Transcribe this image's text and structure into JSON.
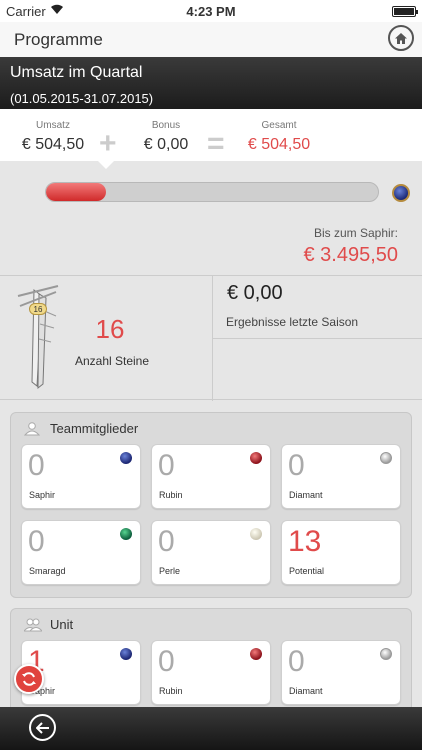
{
  "statusbar": {
    "carrier": "Carrier",
    "time": "4:23 PM"
  },
  "navbar": {
    "title": "Programme",
    "home_icon": "home-icon"
  },
  "quarter": {
    "title": "Umsatz im Quartal",
    "period": "(01.05.2015-31.07.2015)"
  },
  "summary": {
    "umsatz_label": "Umsatz",
    "umsatz_value": "€ 504,50",
    "plus": "+",
    "bonus_label": "Bonus",
    "bonus_value": "€ 0,00",
    "equals": "=",
    "gesamt_label": "Gesamt",
    "gesamt_value": "€ 504,50"
  },
  "progress": {
    "fraction": 0.18,
    "bis_label": "Bis zum Saphir:",
    "bis_value": "€ 3.495,50"
  },
  "stones": {
    "badge": "16",
    "count": "16",
    "label": "Anzahl Steine"
  },
  "saison": {
    "value": "€ 0,00",
    "label": "Ergebnisse letzte Saison"
  },
  "team": {
    "header": "Teammitglieder",
    "cards": [
      {
        "value": "0",
        "name": "Saphir",
        "gem": "saphir"
      },
      {
        "value": "0",
        "name": "Rubin",
        "gem": "rubin"
      },
      {
        "value": "0",
        "name": "Diamant",
        "gem": "diamant"
      },
      {
        "value": "0",
        "name": "Smaragd",
        "gem": "smaragd"
      },
      {
        "value": "0",
        "name": "Perle",
        "gem": "perle"
      },
      {
        "value": "13",
        "name": "Potential",
        "gem": ""
      }
    ]
  },
  "unit": {
    "header": "Unit",
    "cards": [
      {
        "value": "1",
        "name": "Saphir",
        "gem": "saphir"
      },
      {
        "value": "0",
        "name": "Rubin",
        "gem": "rubin"
      },
      {
        "value": "0",
        "name": "Diamant",
        "gem": "diamant"
      }
    ]
  },
  "colors": {
    "accent_red": "#e04b4b",
    "bar_dark": "#1c1c1c"
  }
}
